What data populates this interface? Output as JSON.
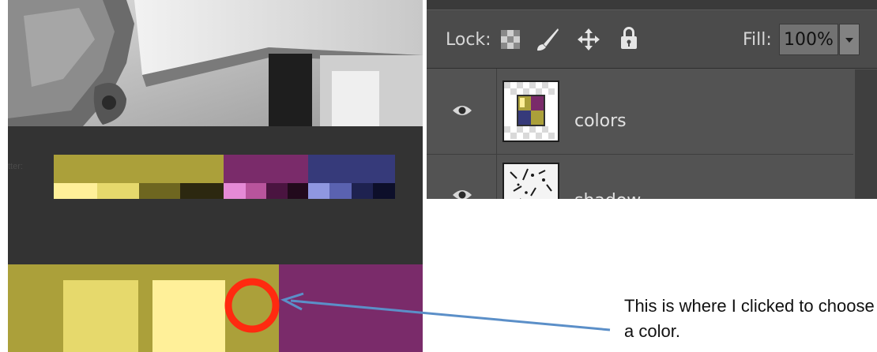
{
  "photoshop_panel": {
    "lock_label": "Lock:",
    "fill_label": "Fill:",
    "fill_value": "100%",
    "lock_icons": [
      "transparency-lock-icon",
      "brush-lock-icon",
      "move-lock-icon",
      "padlock-icon"
    ],
    "layers": [
      {
        "name": "colors",
        "visible": true
      },
      {
        "name": "shadow",
        "visible": true
      }
    ]
  },
  "palette": {
    "main_colors": [
      "#aba03a",
      "#7a2b6a",
      "#363a7a"
    ],
    "yellow_shades": [
      "#fff099",
      "#e6d96c",
      "#6e6620",
      "#2c2810"
    ],
    "purple_shades": [
      "#e58ad6",
      "#b8549c",
      "#4a1440",
      "#220a1c"
    ],
    "blue_shades": [
      "#8f97e0",
      "#5a62b0",
      "#1e2250",
      "#0d0f2a"
    ]
  },
  "annotation": {
    "text": "This is where I clicked to choose a color.",
    "circle_color": "#ff2a10",
    "arrow_color": "#5b8fc8"
  }
}
